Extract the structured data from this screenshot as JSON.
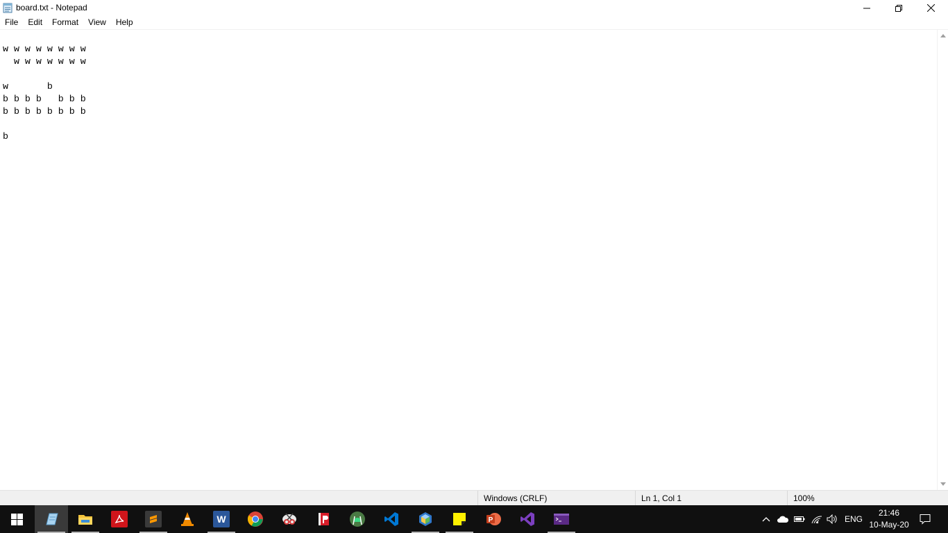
{
  "window": {
    "title": "board.txt - Notepad"
  },
  "menu": {
    "items": [
      {
        "id": "file",
        "label": "File"
      },
      {
        "id": "edit",
        "label": "Edit"
      },
      {
        "id": "format",
        "label": "Format"
      },
      {
        "id": "view",
        "label": "View"
      },
      {
        "id": "help",
        "label": "Help"
      }
    ]
  },
  "editor": {
    "content": "w w w w w w w w\n  w w w w w w w\n\nw       b\nb b b b   b b b\nb b b b b b b b\n\nb"
  },
  "statusbar": {
    "encoding": "Windows (CRLF)",
    "position": "Ln 1, Col 1",
    "zoom": "100%"
  },
  "taskbar": {
    "apps": [
      {
        "name": "notepad",
        "icon": "notepad-icon",
        "color": "#7fb3d5",
        "running": true,
        "active": true
      },
      {
        "name": "file-explorer",
        "icon": "folder-icon",
        "color": "#f3c33c",
        "running": true
      },
      {
        "name": "acrobat-reader",
        "icon": "pdf-icon",
        "color": "#d0151b",
        "running": false
      },
      {
        "name": "sublime-text",
        "icon": "sublime-icon",
        "color": "#ff9800",
        "running": true
      },
      {
        "name": "vlc",
        "icon": "vlc-cone-icon",
        "color": "#f08a00",
        "running": false
      },
      {
        "name": "word",
        "icon": "word-icon",
        "color": "#2b579a",
        "running": true
      },
      {
        "name": "chrome",
        "icon": "chrome-icon",
        "color": "#4285f4",
        "running": false
      },
      {
        "name": "snipping-tool",
        "icon": "scissors-icon",
        "color": "#d83b3b",
        "running": false
      },
      {
        "name": "reader-app",
        "icon": "reader-icon",
        "color": "#d81e2a",
        "running": false
      },
      {
        "name": "android-studio",
        "icon": "android-icon",
        "color": "#3ddc84",
        "running": false
      },
      {
        "name": "vscode",
        "icon": "vscode-icon",
        "color": "#0078d4",
        "running": false
      },
      {
        "name": "virtualbox",
        "icon": "cube-icon",
        "color": "#2f77c8",
        "running": true
      },
      {
        "name": "sticky-notes",
        "icon": "sticky-note-icon",
        "color": "#fff100",
        "running": true
      },
      {
        "name": "powerpoint",
        "icon": "powerpoint-icon",
        "color": "#d24726",
        "running": false
      },
      {
        "name": "visual-studio",
        "icon": "visual-studio-icon",
        "color": "#7b3fbf",
        "running": false
      },
      {
        "name": "terminal",
        "icon": "terminal-icon",
        "color": "#5b2a86",
        "running": true
      }
    ],
    "tray": {
      "language": "ENG",
      "time": "21:46",
      "date": "10-May-20"
    }
  }
}
